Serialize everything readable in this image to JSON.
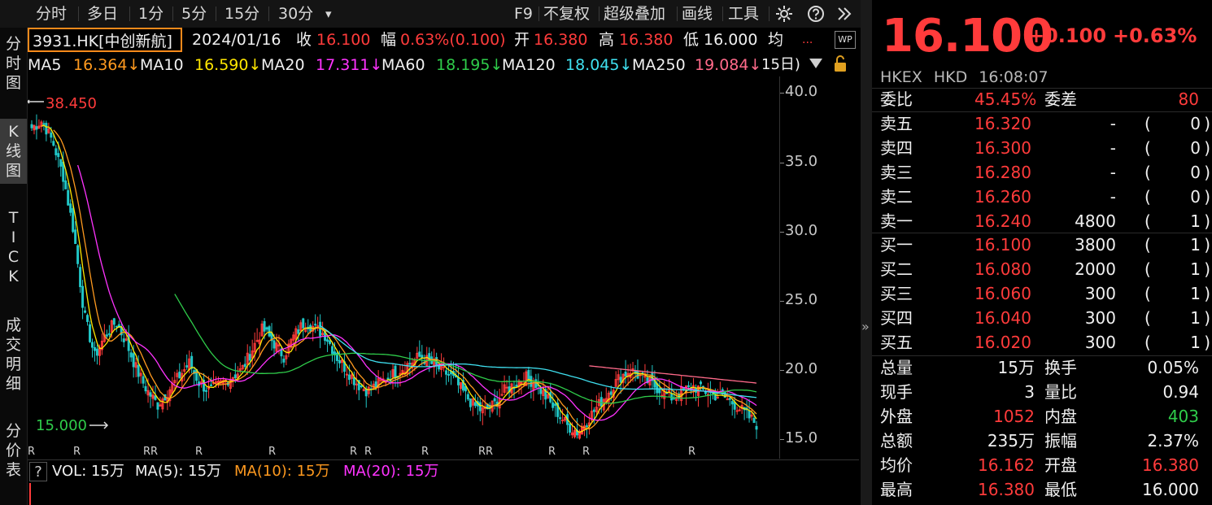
{
  "toolbar": {
    "periods": [
      "分时",
      "多日",
      "1分",
      "5分",
      "15分",
      "30分"
    ],
    "more_caret": "▾",
    "right_items": [
      "F9",
      "不复权",
      "超级叠加",
      "画线",
      "工具"
    ]
  },
  "info": {
    "stock": "3931.HK[中创新航]",
    "date": "2024/01/16",
    "close_label": "收",
    "close": "16.100",
    "range_label": "幅",
    "range": "0.63%(0.100)",
    "open_label": "开",
    "open": "16.380",
    "high_label": "高",
    "high": "16.380",
    "low_label": "低",
    "low": "16.000",
    "avg_label": "均",
    "avg_value": "...",
    "wp_badge": "WP"
  },
  "ma": {
    "ma5_label": "MA5",
    "ma5": "16.364↓",
    "ma10_label": "MA10",
    "ma10": "16.590↓",
    "ma20_label": "MA20",
    "ma20": "17.311↓",
    "ma60_label": "MA60",
    "ma60": "18.195↓",
    "ma120_label": "MA120",
    "ma120": "18.045↓",
    "ma250_label": "MA250",
    "ma250": "19.084↓",
    "extra": "15日)"
  },
  "left_tabs": {
    "t1": [
      "分",
      "时",
      "图"
    ],
    "t2": [
      "K",
      "线",
      "图"
    ],
    "t3": [
      "T",
      "I",
      "C",
      "K"
    ],
    "t4": [
      "成",
      "交",
      "明",
      "细"
    ],
    "t5": [
      "分",
      "价",
      "表"
    ]
  },
  "chart_data": {
    "type": "candlestick",
    "y_ticks": [
      "40.0",
      "35.0",
      "30.0",
      "25.0",
      "20.0",
      "15.0"
    ],
    "ylim": [
      13.6,
      41.2
    ],
    "max_label": "38.450",
    "min_label": "15.000",
    "r_markers": [
      "R",
      "R",
      "RR",
      "R",
      "R",
      "R",
      "R",
      "R",
      "RR",
      "R",
      "R",
      "R"
    ],
    "series": [
      {
        "name": "MA5",
        "color": "#ffe600"
      },
      {
        "name": "MA10",
        "color": "#ff9a1f"
      },
      {
        "name": "MA20",
        "color": "#ff33ff"
      },
      {
        "name": "MA60",
        "color": "#2fcc4a"
      },
      {
        "name": "MA120",
        "color": "#3fe0f0"
      },
      {
        "name": "MA250",
        "color": "#ff6a8a"
      }
    ],
    "close_path": [
      37.5,
      38.0,
      36.5,
      34.0,
      30.0,
      24.0,
      21.0,
      22.5,
      23.5,
      22.0,
      20.0,
      18.5,
      17.5,
      18.5,
      19.5,
      20.5,
      19.0,
      18.5,
      19.0,
      19.5,
      20.0,
      21.5,
      23.0,
      22.0,
      21.0,
      22.5,
      23.5,
      23.0,
      22.5,
      21.0,
      20.0,
      19.0,
      18.5,
      19.0,
      19.5,
      20.0,
      20.5,
      21.0,
      20.5,
      20.0,
      19.5,
      18.5,
      17.5,
      17.0,
      17.5,
      18.5,
      19.0,
      19.5,
      19.0,
      18.0,
      17.0,
      16.0,
      15.5,
      16.5,
      17.5,
      18.5,
      19.5,
      20.0,
      19.5,
      19.0,
      18.5,
      18.0,
      18.5,
      18.8,
      18.5,
      18.2,
      18.0,
      17.5,
      16.8,
      16.1
    ]
  },
  "volume": {
    "q": "?",
    "vol": "VOL: 15万",
    "ma5": "MA(5): 15万",
    "ma10": "MA(10): 15万",
    "ma20": "MA(20): 15万"
  },
  "quote": {
    "price": "16.100",
    "change": "+0.100",
    "change_pct": "+0.63%",
    "exchange": "HKEX",
    "currency": "HKD",
    "time": "16:08:07",
    "wb_label": "委比",
    "wb_value": "45.45%",
    "wc_label": "委差",
    "wc_value": "80",
    "asks": [
      {
        "label": "卖五",
        "price": "16.320",
        "vol": "-",
        "cnt": "0"
      },
      {
        "label": "卖四",
        "price": "16.300",
        "vol": "-",
        "cnt": "0"
      },
      {
        "label": "卖三",
        "price": "16.280",
        "vol": "-",
        "cnt": "0"
      },
      {
        "label": "卖二",
        "price": "16.260",
        "vol": "-",
        "cnt": "0"
      },
      {
        "label": "卖一",
        "price": "16.240",
        "vol": "4800",
        "cnt": "1"
      }
    ],
    "bids": [
      {
        "label": "买一",
        "price": "16.100",
        "vol": "3800",
        "cnt": "1"
      },
      {
        "label": "买二",
        "price": "16.080",
        "vol": "2000",
        "cnt": "1"
      },
      {
        "label": "买三",
        "price": "16.060",
        "vol": "300",
        "cnt": "1"
      },
      {
        "label": "买四",
        "price": "16.040",
        "vol": "300",
        "cnt": "1"
      },
      {
        "label": "买五",
        "price": "16.020",
        "vol": "300",
        "cnt": "1"
      }
    ],
    "stats": [
      {
        "l1": "总量",
        "v1": "15万",
        "l2": "换手",
        "v2": "0.05%",
        "c1": "white",
        "c2": "white"
      },
      {
        "l1": "现手",
        "v1": "3",
        "l2": "量比",
        "v2": "0.94",
        "c1": "white",
        "c2": "white"
      },
      {
        "l1": "外盘",
        "v1": "1052",
        "l2": "内盘",
        "v2": "403",
        "c1": "red",
        "c2": "green"
      },
      {
        "l1": "总额",
        "v1": "235万",
        "l2": "振幅",
        "v2": "2.37%",
        "c1": "white",
        "c2": "white"
      },
      {
        "l1": "均价",
        "v1": "16.162",
        "l2": "开盘",
        "v2": "16.380",
        "c1": "red",
        "c2": "red"
      },
      {
        "l1": "最高",
        "v1": "16.380",
        "l2": "最低",
        "v2": "16.000",
        "c1": "red",
        "c2": "white"
      }
    ]
  }
}
